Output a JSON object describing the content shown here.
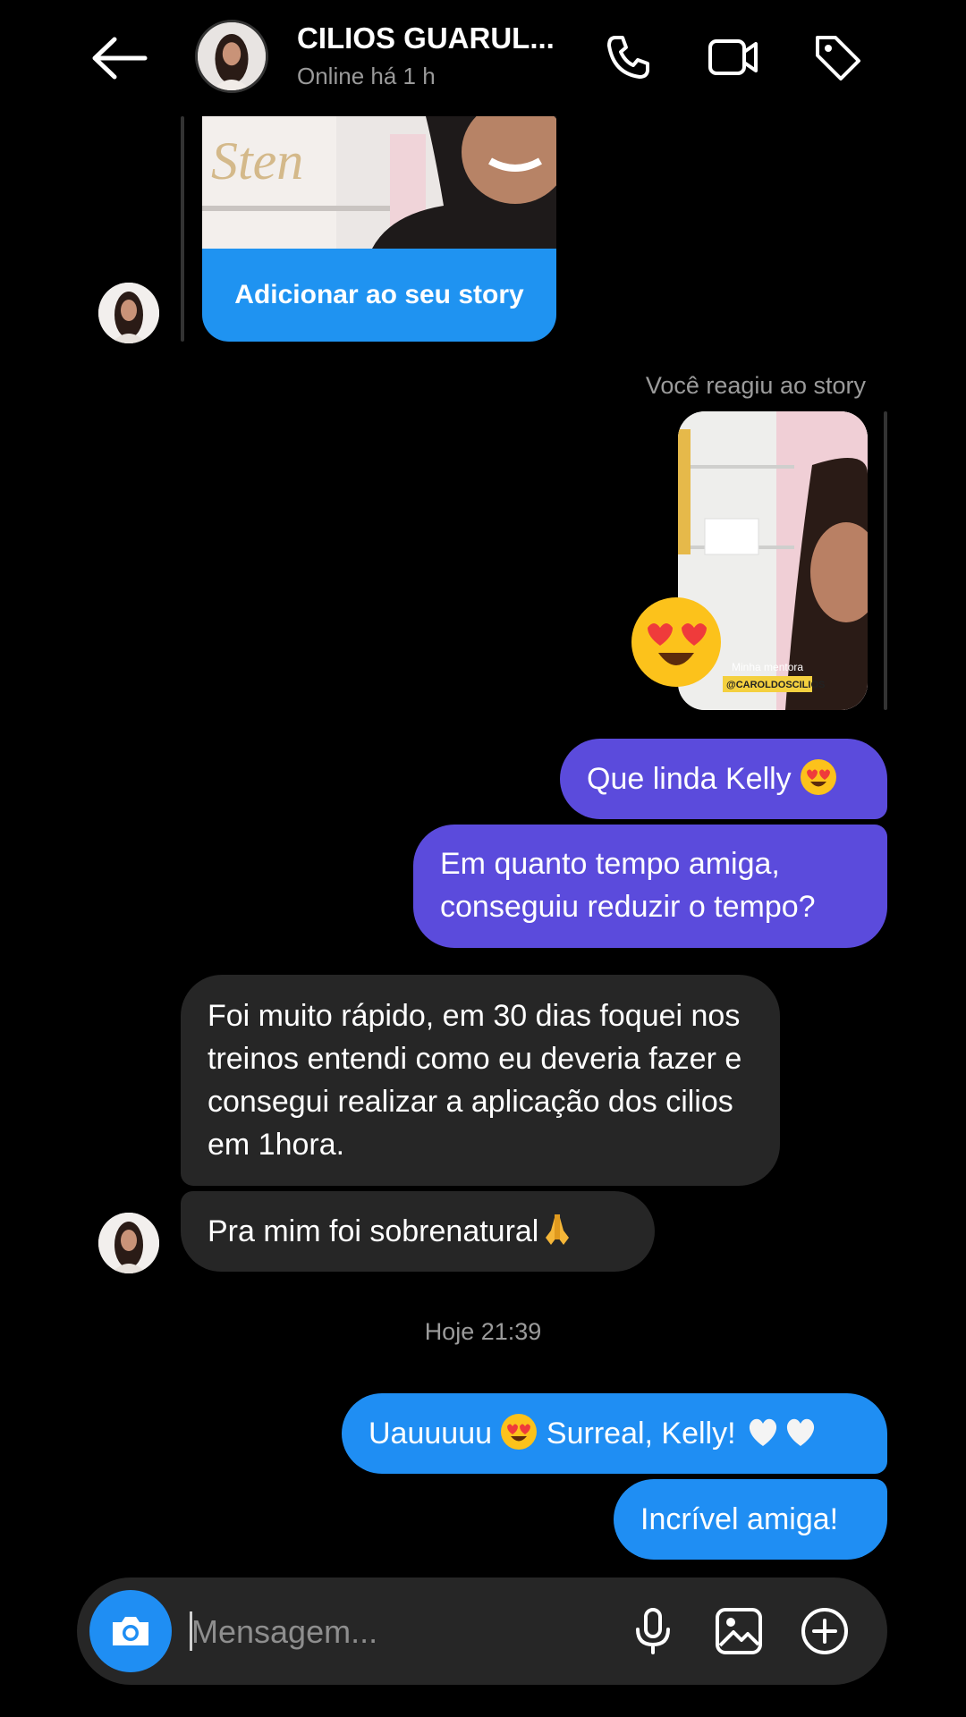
{
  "header": {
    "title": "CILIOS GUARUL...",
    "status": "Online há 1 h"
  },
  "shared_story": {
    "button_label": "Adicionar ao seu story"
  },
  "reaction": {
    "label": "Você reagiu ao story",
    "story_caption": "Minha mentora",
    "story_tag": "@CAROLDOSCILIOS",
    "reaction_emoji": "heart-eyes"
  },
  "messages": [
    {
      "from": "me",
      "text": "Que linda Kelly",
      "emoji": "heart-eyes"
    },
    {
      "from": "me",
      "text": "Em quanto tempo amiga, conseguiu reduzir o tempo?"
    },
    {
      "from": "them",
      "text": "Foi muito rápido, em 30 dias foquei nos treinos entendi como eu deveria fazer e consegui realizar a aplicação dos cilios em 1hora."
    },
    {
      "from": "them",
      "text": "Pra mim foi sobrenatural",
      "emoji": "folded-hands"
    },
    {
      "from": "me",
      "text_a": "Uauuuuu",
      "text_b": "Surreal, Kelly!",
      "emoji": "heart-eyes",
      "trailing": "white-hearts"
    },
    {
      "from": "me",
      "text": "Incrível amiga!"
    }
  ],
  "timestamp": "Hoje 21:39",
  "composer": {
    "placeholder": "Mensagem..."
  },
  "colors": {
    "sent_purple": "#5b4bdc",
    "sent_blue": "#1f8ef3",
    "received": "#262626",
    "accent": "#1f93f1"
  }
}
